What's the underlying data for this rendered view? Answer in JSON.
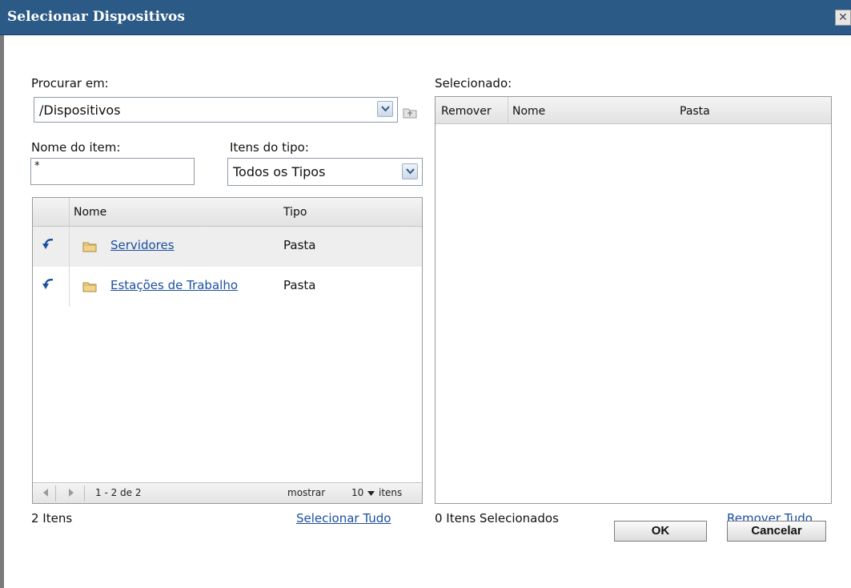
{
  "dialog": {
    "title": "Selecionar Dispositivos",
    "close_glyph": "✕"
  },
  "browse": {
    "label": "Procurar em:",
    "value": "/Dispositivos"
  },
  "item_name": {
    "label": "Nome do item:",
    "value": "*"
  },
  "item_type": {
    "label": "Itens do tipo:",
    "value": "Todos os Tipos"
  },
  "list": {
    "headers": {
      "name": "Nome",
      "type": "Tipo"
    },
    "rows": [
      {
        "name": "Servidores",
        "type": "Pasta"
      },
      {
        "name": "Estações de Trabalho",
        "type": "Pasta"
      }
    ],
    "pager": {
      "range": "1 - 2 de 2",
      "show_label": "mostrar",
      "page_size": "10",
      "items_label": "itens"
    },
    "count_text": "2 Itens",
    "select_all": "Selecionar Tudo"
  },
  "selected": {
    "label": "Selecionado:",
    "headers": {
      "remove": "Remover",
      "name": "Nome",
      "folder": "Pasta"
    },
    "count_text": "0 Itens Selecionados",
    "remove_all": "Remover Tudo"
  },
  "buttons": {
    "ok": "OK",
    "cancel": "Cancelar"
  },
  "icons": {
    "drill": "drill-down-arrow-icon",
    "folder": "folder-icon",
    "dropdown": "chevron-down-icon",
    "up": "up-folder-icon"
  },
  "colors": {
    "title_bar": "#2b5a86",
    "link": "#1b4fa0",
    "row_alt": "#eeeeee"
  }
}
